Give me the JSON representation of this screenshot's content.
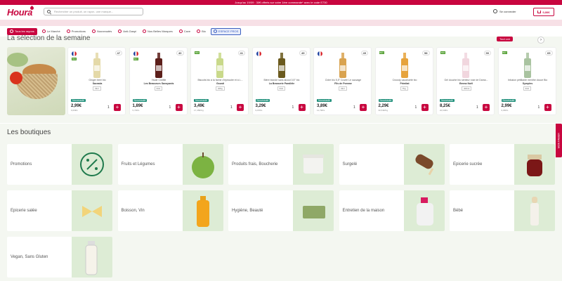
{
  "promo_banner": "Jusqu'au 19/09 : 30€ offerts sur votre 1ère commande* avec le code E730",
  "header": {
    "logo": "Houra",
    "search_placeholder": "Rechercher un produit, un rayon, une marque...",
    "login_label": "Se connecter",
    "cart_total": "0,00€"
  },
  "nav": {
    "items": [
      {
        "label": "Tous les rayons",
        "type": "primary"
      },
      {
        "label": "Le Marché",
        "type": "normal"
      },
      {
        "label": "Promotions",
        "type": "normal"
      },
      {
        "label": "Nouveautés",
        "type": "normal"
      },
      {
        "label": "Anti-Gaspi",
        "type": "normal"
      },
      {
        "label": "Nos Belles Marques",
        "type": "normal"
      },
      {
        "label": "Cave",
        "type": "normal"
      },
      {
        "label": "Bio",
        "type": "normal"
      },
      {
        "label": "ESPACE PROS",
        "type": "pro"
      }
    ]
  },
  "selection": {
    "title": "La sélection de la semaine",
    "see_all": "Tout voir",
    "products": [
      {
        "flag": true,
        "bio": true,
        "score": "47",
        "name": "Ginger beer bio",
        "brand": "Sacrada",
        "size": "33cl",
        "badge": "Nouveauté",
        "price": "2,99€",
        "unit_price": "9,06€/L",
        "qty": "1",
        "color": "#e4d9a8"
      },
      {
        "flag": true,
        "bio": true,
        "score": "40",
        "name": "Yaute Cidrifie",
        "brand": "Les Brasseurs Savoyards",
        "size": "33cl",
        "badge": "Nouveauté",
        "price": "1,89€",
        "unit_price": "5,73€/L",
        "qty": "1",
        "color": "#5c1f1a"
      },
      {
        "flag": false,
        "bio": true,
        "score": "41",
        "name": "Biscuits bio à la farine d'épeautre et à L...",
        "brand": "Gousti",
        "size": "200g",
        "badge": "Nouveauté",
        "price": "3,49€",
        "unit_price": "17,45€/Kg",
        "qty": "1",
        "color": "#c9d98a"
      },
      {
        "flag": true,
        "bio": false,
        "score": "49",
        "name": "Bière blonde sans alcool 0,5° bio",
        "brand": "La Brasserie Parallèle",
        "size": "33cl",
        "badge": "Nouveauté",
        "price": "3,29€",
        "unit_price": "9,97€/L",
        "qty": "1",
        "color": "#6b5a1e"
      },
      {
        "flag": true,
        "bio": false,
        "score": "49",
        "name": "Cidre bio 5,5° Cuvée Le sauvage",
        "brand": "Fils de Pomme",
        "size": "33cl",
        "badge": "Nouveauté",
        "price": "3,89€",
        "unit_price": "11,79€/L",
        "qty": "1",
        "color": "#d9a350"
      },
      {
        "flag": false,
        "bio": true,
        "score": "58",
        "name": "Crousty cacahuète bio",
        "brand": "Primitat",
        "size": "75g",
        "badge": "Nouveauté",
        "price": "2,29€",
        "unit_price": "30,53€/Kg",
        "qty": "1",
        "color": "#e6a33c"
      },
      {
        "flag": false,
        "bio": true,
        "score": "90",
        "name": "Gel douche bio senteur rose de Dama...",
        "brand": "Emma Noël",
        "size": "400ml",
        "badge": "Nouveauté",
        "price": "8,25€",
        "unit_price": "20,63€/L",
        "qty": "1",
        "color": "#f1d6de"
      },
      {
        "flag": false,
        "bio": true,
        "score": "65",
        "name": "Infusion pétillante menthe douce Bio",
        "brand": "Symples",
        "size": "33cl",
        "badge": "Nouveauté",
        "price": "2,99€",
        "unit_price": "9,06€/L",
        "qty": "1",
        "color": "#a9c3a0"
      }
    ]
  },
  "shops": {
    "title": "Les boutiques",
    "items": [
      {
        "label": "Promotions",
        "icon": "percent-icon"
      },
      {
        "label": "Fruits et Légumes",
        "icon": "apple-icon"
      },
      {
        "label": "Produits frais, Boucherie",
        "icon": "yogurt-icon"
      },
      {
        "label": "Surgelé",
        "icon": "icecream-icon"
      },
      {
        "label": "Epicerie sucrée",
        "icon": "jam-jar-icon"
      },
      {
        "label": "Epicerie salée",
        "icon": "pasta-icon"
      },
      {
        "label": "Boisson, Vin",
        "icon": "juice-bottle-icon"
      },
      {
        "label": "Hygiène, Beauté",
        "icon": "soap-icon"
      },
      {
        "label": "Entretien de la maison",
        "icon": "detergent-icon"
      },
      {
        "label": "Bébé",
        "icon": "baby-bottle-icon"
      },
      {
        "label": "Vegan, Sans Gluten",
        "icon": "milk-bottle-icon"
      }
    ]
  },
  "side_tab": "MON PANIER",
  "colors": {
    "brand": "#c8063f",
    "bio_green": "#4f9d2d",
    "new_teal": "#1f8f7a",
    "shop_bg": "#f4f7f1"
  }
}
